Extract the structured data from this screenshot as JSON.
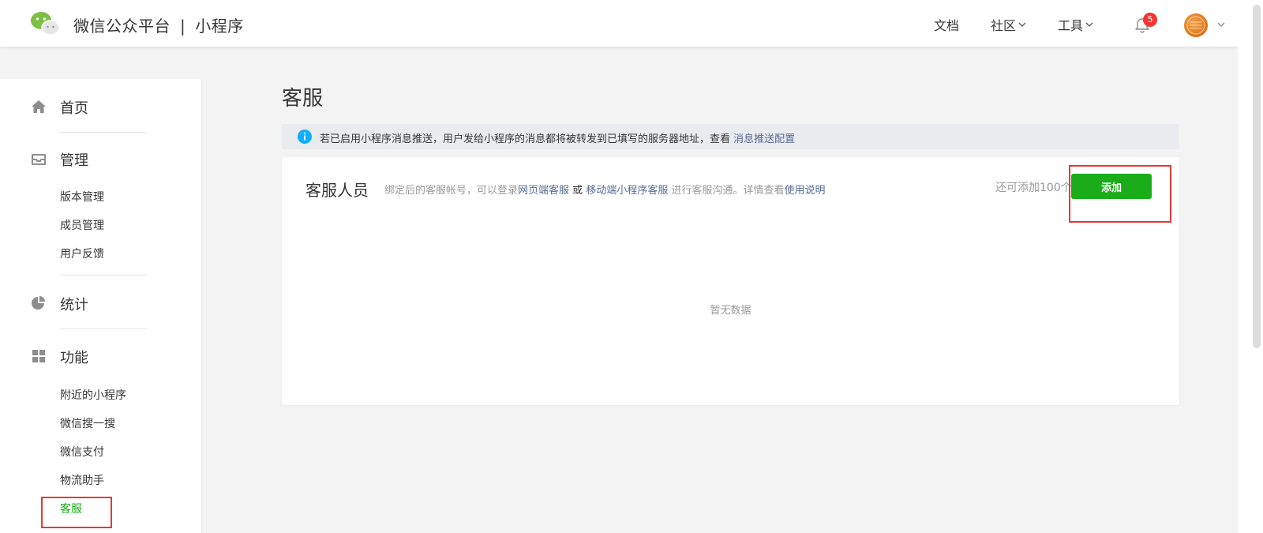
{
  "header": {
    "brand_name": "微信公众平台",
    "brand_sep": "|",
    "brand_product": "小程序",
    "nav": {
      "docs": "文档",
      "community": "社区",
      "tools": "工具"
    },
    "notification_count": "5"
  },
  "sidebar": {
    "home": "首页",
    "manage": "管理",
    "manage_items": [
      "版本管理",
      "成员管理",
      "用户反馈"
    ],
    "stats": "统计",
    "features": "功能",
    "feature_items": [
      "附近的小程序",
      "微信搜一搜",
      "微信支付",
      "物流助手",
      "客服"
    ]
  },
  "main": {
    "title": "客服",
    "notice": {
      "text": "若已启用小程序消息推送，用户发给小程序的消息都将被转发到已填写的服务器地址，查看",
      "link": "消息推送配置"
    },
    "panel": {
      "title": "客服人员",
      "desc_prefix": "绑定后的客服帐号，可以登录",
      "desc_link1": "网页端客服",
      "desc_or": "或",
      "desc_link2": "移动端小程序客服",
      "desc_suffix": "进行客服沟通。详情查看",
      "desc_link3": "使用说明",
      "remain": "还可添加100个",
      "add_button": "添加",
      "empty": "暂无数据"
    }
  },
  "colors": {
    "accent_green": "#1aad19",
    "link_blue": "#576b95",
    "highlight_red": "#e53935",
    "badge_red": "#f43530",
    "info_blue": "#10aeff"
  }
}
